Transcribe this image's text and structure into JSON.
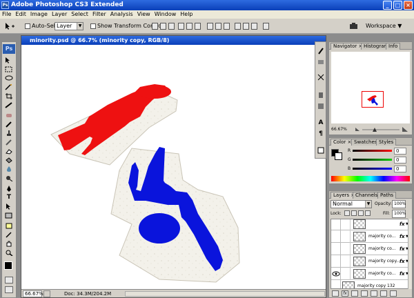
{
  "app": {
    "title": "Adobe Photoshop CS3 Extended",
    "logo": "Ps"
  },
  "menu": [
    "File",
    "Edit",
    "Image",
    "Layer",
    "Select",
    "Filter",
    "Analysis",
    "View",
    "Window",
    "Help"
  ],
  "options": {
    "auto_select_label": "Auto-Select:",
    "auto_select_value": "Layer",
    "show_transform_label": "Show Transform Controls",
    "workspace_label": "Workspace"
  },
  "document": {
    "title": "minority.psd @ 66.7% (minority copy, RGB/8)",
    "zoom": "66.67%",
    "doc_size": "Doc: 34.3M/204.2M"
  },
  "navigator": {
    "tabs": [
      "Navigator",
      "Histogram",
      "Info"
    ],
    "zoom": "66.67%"
  },
  "color_panel": {
    "tabs": [
      "Color",
      "Swatches",
      "Styles"
    ],
    "channels": [
      {
        "label": "R",
        "value": "0"
      },
      {
        "label": "G",
        "value": "0"
      },
      {
        "label": "B",
        "value": "0"
      }
    ]
  },
  "layers": {
    "tabs": [
      "Layers",
      "Channels",
      "Paths"
    ],
    "blend_mode": "Normal",
    "opacity_label": "Opacity:",
    "opacity_value": "100%",
    "lock_label": "Lock:",
    "fill_label": "Fill:",
    "fill_value": "100%",
    "rows": [
      {
        "name": "",
        "fx": "fx"
      },
      {
        "name": "majority co...",
        "fx": "fx"
      },
      {
        "name": "majority co...",
        "fx": "fx"
      },
      {
        "name": "majority copy...",
        "fx": "fx"
      },
      {
        "name": "majority co...",
        "fx": "fx"
      },
      {
        "name": "majority copy 132",
        "fx": ""
      }
    ]
  },
  "colors": {
    "red_figure": "#ee1111",
    "blue_figure": "#0a14dc",
    "titlebar": "#0a3fb8"
  }
}
